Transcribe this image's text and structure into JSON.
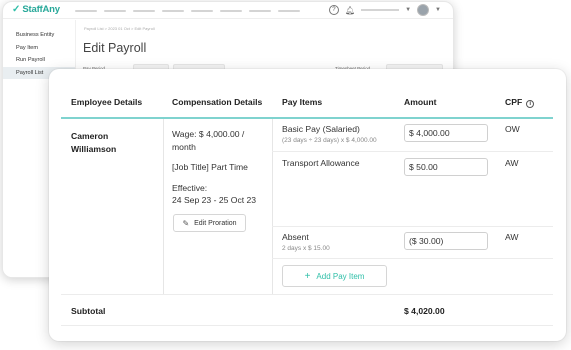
{
  "app": {
    "logo_text": "StaffAny",
    "sidebar": {
      "items": [
        {
          "label": "Business Entity"
        },
        {
          "label": "Pay Item"
        },
        {
          "label": "Run Payroll"
        },
        {
          "label": "Payroll List"
        }
      ]
    },
    "breadcrumb": "Payroll List  >  2023 01 Oct  >  Edit Payroll",
    "breadcrumb_current": "Edit Payroll",
    "page_title": "Edit Payroll",
    "filters": {
      "pay_period_label": "Pay Period",
      "timesheet_period_label": "Timesheet Period"
    }
  },
  "table": {
    "headers": {
      "employee": "Employee Details",
      "compensation": "Compensation Details",
      "pay_items": "Pay Items",
      "amount": "Amount",
      "cpf": "CPF"
    },
    "employee": {
      "name_line1": "Cameron",
      "name_line2": "Williamson"
    },
    "compensation": {
      "wage_line1": "Wage: $ 4,000.00 /",
      "wage_line2": "month",
      "job": "[Job Title]  Part Time",
      "effective_label": "Effective:",
      "effective_dates": "24 Sep 23 - 25 Oct 23",
      "edit_proration_label": "Edit Proration"
    },
    "pay_items": [
      {
        "name": "Basic Pay (Salaried)",
        "detail": "(23 days ÷ 23 days) x $ 4,000.00",
        "amount": "$ 4,000.00",
        "cpf": "OW"
      },
      {
        "name": "Transport Allowance",
        "detail": "",
        "amount": "$ 50.00",
        "cpf": "AW"
      },
      {
        "name": "Absent",
        "detail": "2 days x $ 15.00",
        "amount": "($ 30.00)",
        "cpf": "AW"
      }
    ],
    "add_pay_item_label": "Add Pay Item",
    "subtotal_label": "Subtotal",
    "subtotal_amount": "$ 4,020.00"
  },
  "colors": {
    "accent": "#2fbfa8",
    "header_rule": "#7fd3cf",
    "sidebar_active": "#e9eef1"
  }
}
